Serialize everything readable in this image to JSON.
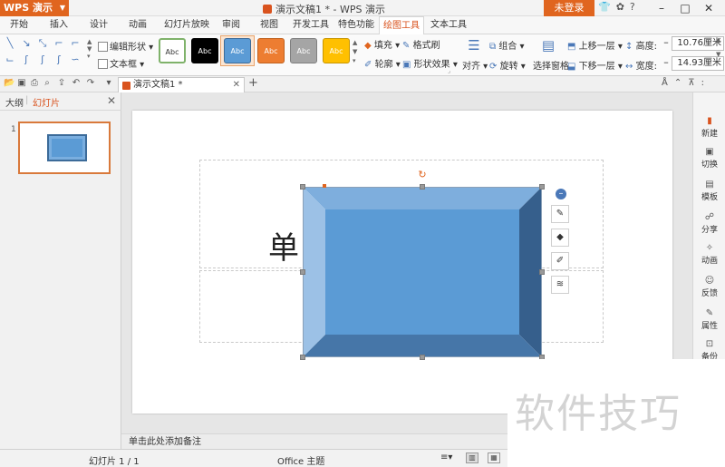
{
  "titlebar": {
    "app_name": "WPS 演示",
    "doc_title": "演示文稿1 * - WPS 演示",
    "login": "未登录"
  },
  "menu": {
    "tabs": [
      "开始",
      "插入",
      "设计",
      "动画",
      "幻灯片放映",
      "审阅",
      "视图",
      "开发工具",
      "特色功能",
      "绘图工具",
      "文本工具"
    ],
    "active": "绘图工具"
  },
  "ribbon": {
    "edit_shape": "编辑形状",
    "textbox": "文本框",
    "style_label": "Abc",
    "fill": "填充",
    "format_painter": "格式刷",
    "outline": "轮廓",
    "shape_effect": "形状效果",
    "align": "对齐",
    "group": "组合",
    "rotate": "旋转",
    "select_pane": "选择窗格",
    "bring_forward": "上移一层",
    "send_backward": "下移一层",
    "height_label": "高度:",
    "height_value": "10.76厘米",
    "width_label": "宽度:",
    "width_value": "14.93厘米",
    "styles": [
      {
        "bg": "#ffffff",
        "fg": "#333333",
        "border": "#7fb26a"
      },
      {
        "bg": "#000000",
        "fg": "#ffffff",
        "border": "#000000"
      },
      {
        "bg": "#5b9bd5",
        "fg": "#ffffff",
        "border": "#3c6b99"
      },
      {
        "bg": "#ed7d31",
        "fg": "#ffffff",
        "border": "#c0611f"
      },
      {
        "bg": "#a5a5a5",
        "fg": "#ffffff",
        "border": "#7f7f7f"
      },
      {
        "bg": "#ffc000",
        "fg": "#ffffff",
        "border": "#c89600"
      }
    ]
  },
  "doc_tab": {
    "name": "演示文稿1 *"
  },
  "left_panel": {
    "outline_tab": "大纲",
    "slides_tab": "幻灯片",
    "slide_number": "1"
  },
  "slide": {
    "title_char": "单",
    "shape_color": "#5b9bd5"
  },
  "right_sidebar": {
    "items": [
      "新建",
      "切换",
      "模板",
      "分享",
      "动画",
      "反馈",
      "属性",
      "备份"
    ]
  },
  "notes_placeholder": "单击此处添加备注",
  "status": {
    "slide_count": "幻灯片 1 / 1",
    "theme": "Office 主题"
  },
  "watermark": "软件技巧"
}
